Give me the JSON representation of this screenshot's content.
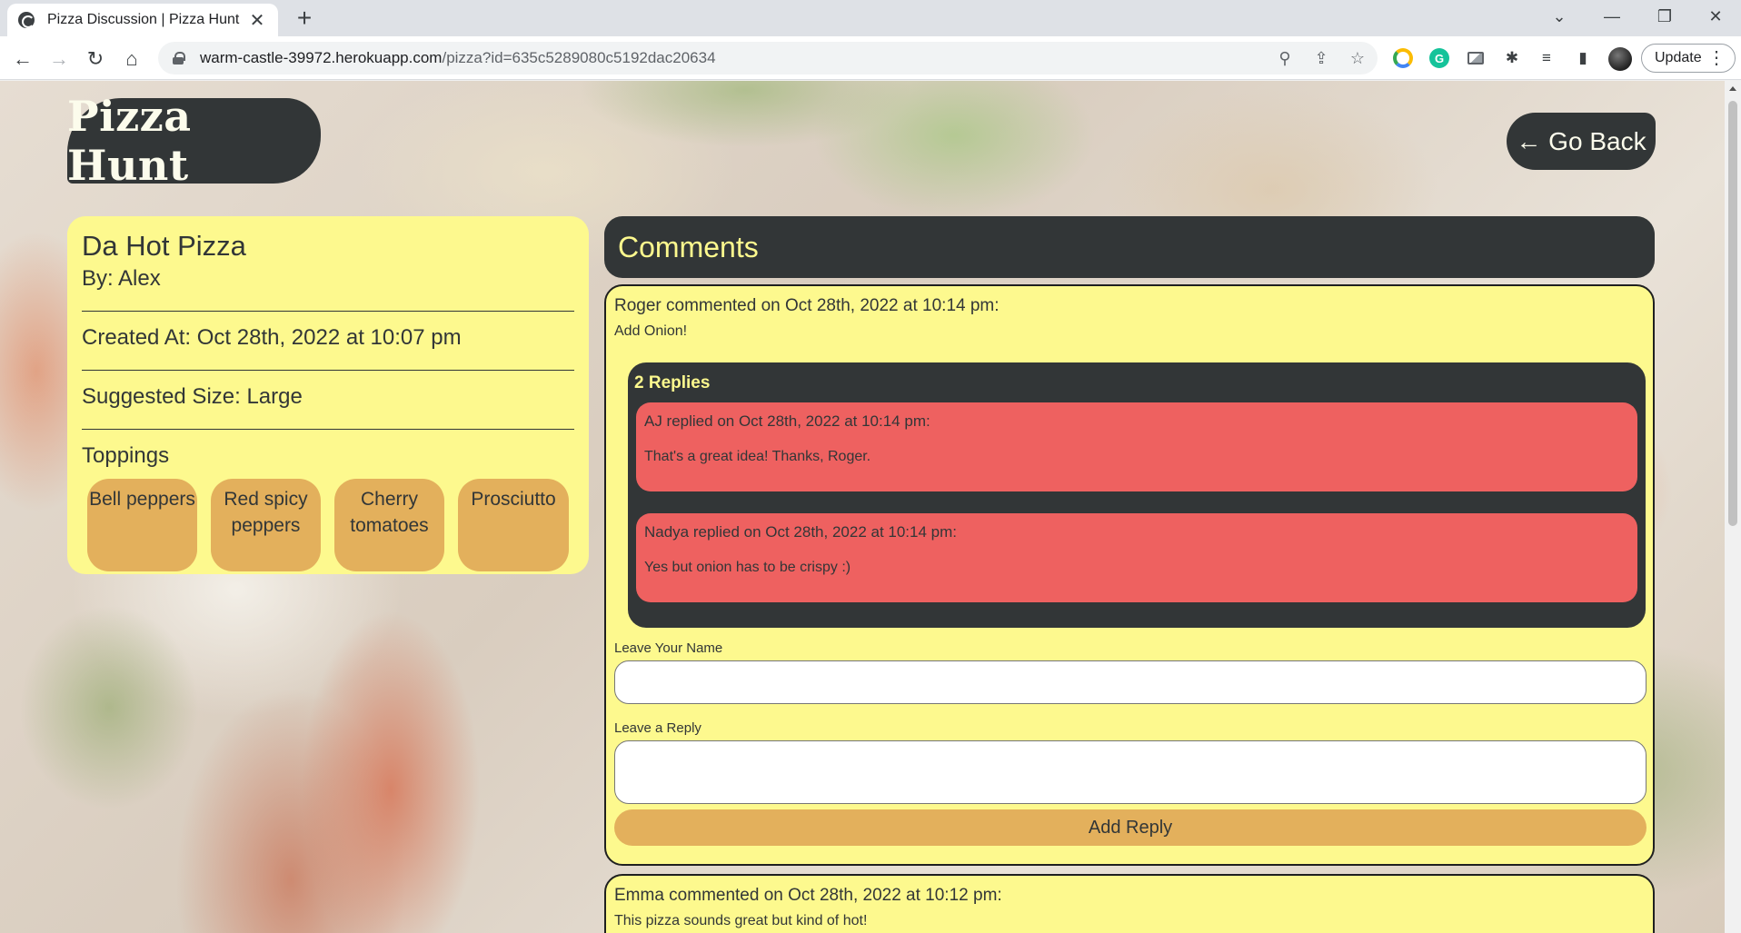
{
  "browser": {
    "tab_title": "Pizza Discussion | Pizza Hunt",
    "tab_close": "✕",
    "new_tab": "+",
    "url_host": "warm-castle-39972.herokuapp.com",
    "url_path": "/pizza?id=635c5289080c5192dac20634",
    "update_label": "Update",
    "menu_glyph": "⋮",
    "win_chevron": "⌄",
    "win_minimize": "—",
    "win_restore": "❐",
    "win_close": "✕",
    "back": "←",
    "forward": "→",
    "reload": "↻",
    "home": "⌂",
    "zoom_glyph": "⚲",
    "share_glyph": "⇪",
    "star_glyph": "☆",
    "extensions_glyph": "✱",
    "media_glyph": "≡",
    "sidepanel_glyph": "▮",
    "ext_letter": "G"
  },
  "header": {
    "logo": "Pizza Hunt",
    "go_back": "← Go Back"
  },
  "pizza": {
    "name": "Da Hot Pizza",
    "by": "By: Alex",
    "created_at": "Created At: Oct 28th, 2022 at 10:07 pm",
    "size": "Suggested Size: Large",
    "toppings_title": "Toppings",
    "toppings": [
      "Bell peppers",
      "Red spicy peppers",
      "Cherry tomatoes",
      "Prosciutto"
    ]
  },
  "comments": {
    "title": "Comments",
    "items": [
      {
        "meta": "Roger commented on Oct 28th, 2022 at 10:14 pm:",
        "text": "Add Onion!",
        "replies_label": "2 Replies",
        "replies": [
          {
            "meta": "AJ replied on Oct 28th, 2022 at 10:14 pm:",
            "text": "That's a great idea! Thanks, Roger."
          },
          {
            "meta": "Nadya replied on Oct 28th, 2022 at 10:14 pm:",
            "text": "Yes but onion has to be crispy :)"
          }
        ],
        "name_label": "Leave Your Name",
        "name_value": "",
        "reply_label": "Leave a Reply",
        "reply_value": "",
        "submit_label": "Add Reply"
      },
      {
        "meta": "Emma commented on Oct 28th, 2022 at 10:12 pm:",
        "text": "This pizza sounds great but kind of hot!"
      }
    ]
  },
  "colors": {
    "dark": "#323637",
    "yellow": "#fdf98e",
    "mustard": "#e3b05c",
    "coral": "#ee6160"
  }
}
